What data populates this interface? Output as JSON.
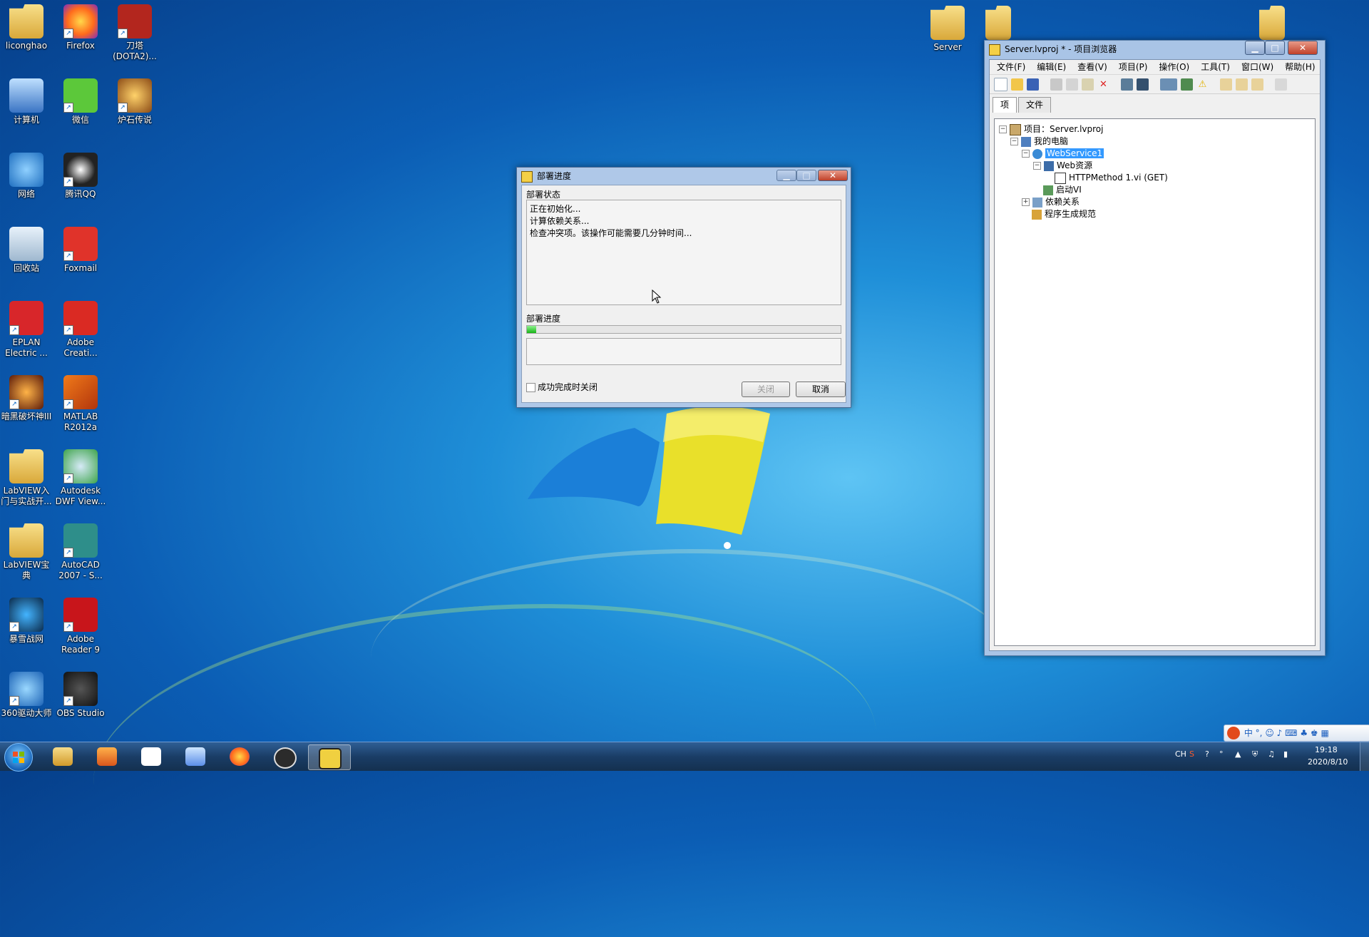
{
  "desktop": {
    "icons": [
      {
        "label": "liconghao",
        "kind": "folder"
      },
      {
        "label": "Firefox",
        "kind": "firefox"
      },
      {
        "label": "刀塔 (DOTA2)...",
        "kind": "dota"
      },
      {
        "label": "计算机",
        "kind": "computer"
      },
      {
        "label": "微信",
        "kind": "wechat"
      },
      {
        "label": "炉石传说",
        "kind": "hearthstone"
      },
      {
        "label": "网络",
        "kind": "network"
      },
      {
        "label": "腾讯QQ",
        "kind": "qq"
      },
      {
        "label": "回收站",
        "kind": "recycle"
      },
      {
        "label": "Foxmail",
        "kind": "foxmail"
      },
      {
        "label": "EPLAN Electric ...",
        "kind": "eplan"
      },
      {
        "label": "Adobe Creati...",
        "kind": "adobe-cc"
      },
      {
        "label": "暗黑破坏神III",
        "kind": "diablo"
      },
      {
        "label": "MATLAB R2012a",
        "kind": "matlab"
      },
      {
        "label": "LabVIEW入门与实战开...",
        "kind": "folder"
      },
      {
        "label": "Autodesk DWF View...",
        "kind": "autodesk"
      },
      {
        "label": "LabVIEW宝典",
        "kind": "folder"
      },
      {
        "label": "AutoCAD 2007 - S...",
        "kind": "autocad"
      },
      {
        "label": "暴雪战网",
        "kind": "battlenet"
      },
      {
        "label": "Adobe Reader 9",
        "kind": "reader"
      },
      {
        "label": "360驱动大师",
        "kind": "driver360"
      },
      {
        "label": "OBS Studio",
        "kind": "obs"
      }
    ],
    "top_folders": [
      {
        "label": "Server"
      },
      {
        "label": ""
      },
      {
        "label": ""
      }
    ]
  },
  "project_browser": {
    "title": "Server.lvproj * - 项目浏览器",
    "menu": [
      "文件(F)",
      "编辑(E)",
      "查看(V)",
      "项目(P)",
      "操作(O)",
      "工具(T)",
      "窗口(W)",
      "帮助(H)"
    ],
    "tabs": [
      "项",
      "文件"
    ],
    "tree": [
      {
        "label": "项目：Server.lvproj",
        "icon": "project-icon",
        "expander": "−"
      },
      {
        "label": "我的电脑",
        "icon": "computer-icon",
        "expander": "−"
      },
      {
        "label": "WebService1",
        "icon": "webservice-icon",
        "expander": "−",
        "selected": true
      },
      {
        "label": "Web资源",
        "icon": "folder-icon",
        "expander": "−"
      },
      {
        "label": "HTTPMethod 1.vi (GET)",
        "icon": "vi-icon",
        "expander": ""
      },
      {
        "label": "启动VI",
        "icon": "startup-icon",
        "expander": ""
      },
      {
        "label": "依赖关系",
        "icon": "dependencies-icon",
        "expander": "+"
      },
      {
        "label": "程序生成规范",
        "icon": "build-spec-icon",
        "expander": ""
      }
    ]
  },
  "deploy_dialog": {
    "title": "部署进度",
    "status_label": "部署状态",
    "status_lines": [
      "正在初始化...",
      "计算依赖关系...",
      "检查冲突项。该操作可能需要几分钟时间..."
    ],
    "progress_label": "部署进度",
    "progress": 0.03,
    "close_on_success_label": "成功完成时关闭",
    "close_on_success_checked": false,
    "close_button": "关闭",
    "cancel_button": "取消"
  },
  "taskbar": {
    "apps": [
      "start",
      "explorer",
      "media-player",
      "baidu-netdisk",
      "feishu",
      "firefox",
      "obs",
      "labview"
    ],
    "tray": {
      "lang": "CH",
      "time": "19:18",
      "date": "2020/8/10"
    },
    "ime": [
      "中",
      "°,"
    ]
  }
}
